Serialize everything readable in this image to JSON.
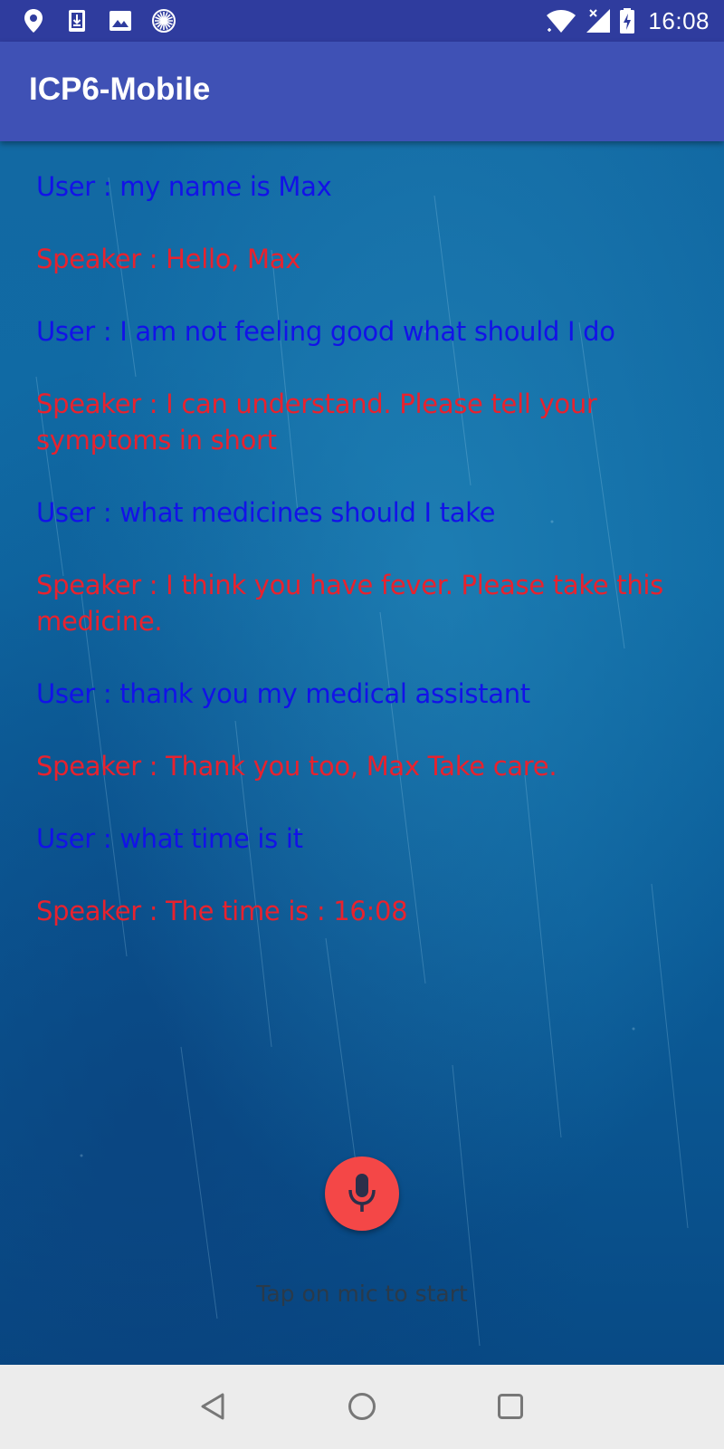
{
  "status_bar": {
    "time": "16:08",
    "left_icons": [
      "location-icon",
      "download-icon",
      "image-icon",
      "sync-icon"
    ],
    "right_icons": [
      "wifi-icon",
      "signal-icon",
      "battery-charging-icon"
    ]
  },
  "app_bar": {
    "title": "ICP6-Mobile",
    "color": "#3f51b5"
  },
  "conversation": {
    "user_color": "#1212e8",
    "speaker_color": "#e8222e",
    "messages": [
      {
        "role": "user",
        "text": "User : my name is Max"
      },
      {
        "role": "speaker",
        "text": "Speaker : Hello, Max"
      },
      {
        "role": "user",
        "text": "User : I am not feeling good what should I do"
      },
      {
        "role": "speaker",
        "text": "Speaker : I can understand. Please tell your symptoms in short"
      },
      {
        "role": "user",
        "text": "User : what medicines should I take"
      },
      {
        "role": "speaker",
        "text": "Speaker : I think you have fever. Please take this medicine."
      },
      {
        "role": "user",
        "text": "User : thank you my medical assistant"
      },
      {
        "role": "speaker",
        "text": "Speaker : Thank you too, Max Take care."
      },
      {
        "role": "user",
        "text": "User : what time is it"
      },
      {
        "role": "speaker",
        "text": "Speaker : The time is : 16:08"
      }
    ]
  },
  "mic": {
    "icon": "microphone-icon",
    "color": "#f44747",
    "hint": "Tap on mic to start"
  },
  "nav_bar": {
    "icons": [
      "back-icon",
      "home-icon",
      "recents-icon"
    ]
  }
}
